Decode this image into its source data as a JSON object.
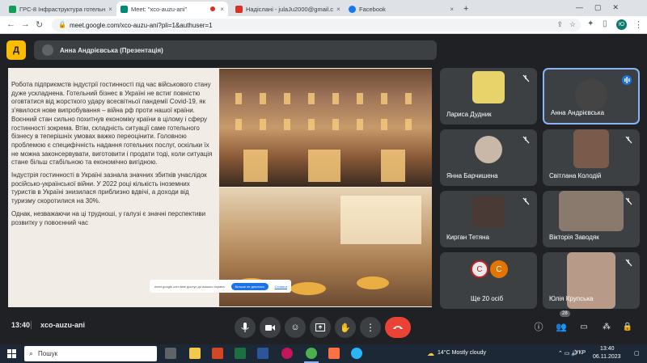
{
  "browser": {
    "tabs": [
      {
        "label": "ГРС-8 Інфраструктура готельн",
        "color": "#0f9d58",
        "active": false
      },
      {
        "label": "Meet: \"xco-auzu-ani\"",
        "color": "#00897b",
        "active": true
      },
      {
        "label": "Надіслані - julaJu2000@gmail.c",
        "color": "#d93025",
        "active": false
      },
      {
        "label": "Facebook",
        "color": "#1877f2",
        "active": false
      }
    ],
    "new_tab": "+",
    "url": "meet.google.com/xco-auzu-ani?pli=1&authuser=1",
    "profile_initials": "Ю"
  },
  "meet": {
    "presenter_name": "Анна Андрієвська (Презентація)",
    "presenter_badge": "Д",
    "slide": {
      "paragraphs": [
        "Робота підприємств індустрії гостинності під час військового стану дуже ускладнена. Готельний бізнес в Україні не встиг повністю оговтатися від жорсткого удару всесвітньої пандемії Covid-19, як з'явилося нове випробування – війна рф проти нашої країни. Воєнний стан сильно похитнув економіку країни в цілому і сферу гостинності зокрема. Втім, складність ситуації саме готельного бізнесу в теперішніх умовах важко переоцінити. Головною проблемою є специфічність надання готельних послуг, оскільки їх не можна законсервувати, виготовити і продати тоді, коли ситуація стане більш стабільною та економічно вигідною.",
        "Індустрія гостинності в Україні зазнала значних збитків унаслідок російсько-української війни. У 2022 році кількість іноземних туристів в Україні знизилася приблизно вдвічі, а доходи від туризму скоротилися на 30%.",
        "Однак, незважаючи на ці трудноші, у галузі є значні перспективи розвитку у повоєнний час"
      ],
      "notice_text": "meet.google.com має доступ до вашого екрана",
      "notice_button": "Більше не ділитися",
      "notice_link": "Сховати"
    },
    "participants": [
      {
        "name": "Лариса Дудник",
        "muted": true,
        "speaking": false
      },
      {
        "name": "Анна Андрієвська",
        "muted": false,
        "speaking": true
      },
      {
        "name": "Янна Барчишена",
        "muted": true,
        "speaking": false
      },
      {
        "name": "Світлана Колодій",
        "muted": true,
        "speaking": false
      },
      {
        "name": "Кирган Тетяна",
        "muted": true,
        "speaking": false
      },
      {
        "name": "Вікторія Заводяк",
        "muted": true,
        "speaking": false
      },
      {
        "name": "Ще 20 осіб",
        "muted": false,
        "speaking": false
      },
      {
        "name": "Юлія Крупська",
        "muted": true,
        "speaking": false
      }
    ],
    "more_avatars": [
      "С",
      "С"
    ],
    "time": "13:40",
    "meeting_code": "xco-auzu-ani",
    "people_count": "28"
  },
  "taskbar": {
    "search_placeholder": "Пошук",
    "weather": "14°C  Mostly cloudy",
    "language": "УКР",
    "clock_time": "13:40",
    "clock_date": "06.11.2023"
  },
  "colors": {
    "accent": "#8ab4f8",
    "end_call": "#ea4335",
    "meet_bg": "#202124"
  }
}
